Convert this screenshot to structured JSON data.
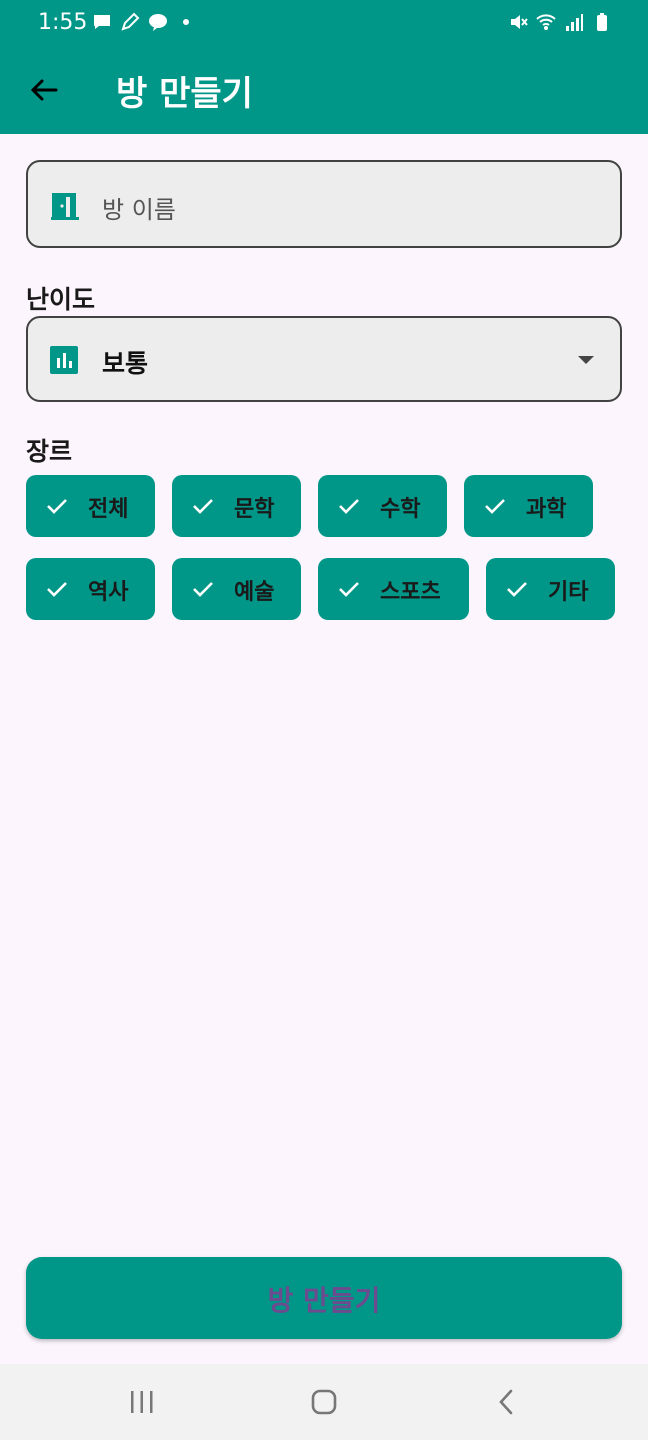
{
  "status_bar": {
    "time": "1:55",
    "left_icons": [
      "message-icon",
      "pen-icon",
      "kakaotalk-icon",
      "dot-icon"
    ],
    "right_icons": [
      "mute-icon",
      "wifi-icon",
      "signal-icon",
      "battery-icon"
    ]
  },
  "app_bar": {
    "title": "방 만들기",
    "back_icon": "arrow-left-icon"
  },
  "room_name_field": {
    "placeholder": "방 이름",
    "icon": "door-icon"
  },
  "difficulty": {
    "label": "난이도",
    "selected": "보통",
    "icon": "bar-chart-icon"
  },
  "genre": {
    "label": "장르",
    "chips": [
      {
        "label": "전체",
        "selected": true
      },
      {
        "label": "문학",
        "selected": true
      },
      {
        "label": "수학",
        "selected": true
      },
      {
        "label": "과학",
        "selected": true
      },
      {
        "label": "역사",
        "selected": true
      },
      {
        "label": "예술",
        "selected": true
      },
      {
        "label": "스포츠",
        "selected": true
      },
      {
        "label": "기타",
        "selected": true
      }
    ]
  },
  "create_button": {
    "label": "방 만들기"
  },
  "nav_bar": {
    "items": [
      "recents-icon",
      "home-icon",
      "back-icon"
    ]
  },
  "colors": {
    "primary": "#009688",
    "background": "#FCF5FD",
    "button_text": "#6C4B8E"
  }
}
